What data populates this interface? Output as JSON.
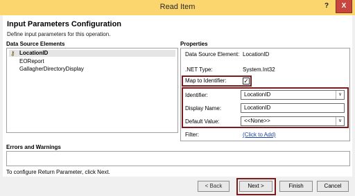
{
  "window": {
    "title": "Read Item",
    "help_label": "?",
    "close_label": "X"
  },
  "header": {
    "title": "Input Parameters Configuration",
    "subtitle": "Define input parameters for this operation."
  },
  "data_source": {
    "label": "Data Source Elements",
    "items": [
      {
        "label": "LocationID",
        "selected": true,
        "icon": "key-icon"
      },
      {
        "label": "EOReport"
      },
      {
        "label": "GallagherDirectoryDisplay"
      }
    ]
  },
  "properties": {
    "label": "Properties",
    "data_source_element_label": "Data Source Element:",
    "data_source_element_value": "LocationID",
    "net_type_label": ".NET Type:",
    "net_type_value": "System.Int32",
    "map_to_identifier_label": "Map to Identifier:",
    "map_to_identifier_checked": true,
    "check_glyph": "✓",
    "identifier_label": "Identifier:",
    "identifier_value": "LocationID",
    "display_name_label": "Display Name:",
    "display_name_value": "LocationID",
    "default_value_label": "Default Value:",
    "default_value_value": "<<None>>",
    "filter_label": "Filter:",
    "filter_link": "(Click to Add)",
    "dropdown_glyph": "∨"
  },
  "errors": {
    "label": "Errors and Warnings",
    "status_text": "To configure Return Parameter, click Next."
  },
  "buttons": {
    "back": "< Back",
    "next": "Next >",
    "finish": "Finish",
    "cancel": "Cancel"
  },
  "colors": {
    "titlebar": "#fbd56e",
    "highlight_border": "#7b1a1a",
    "close_button": "#c7463d",
    "link": "#1a3faa"
  }
}
